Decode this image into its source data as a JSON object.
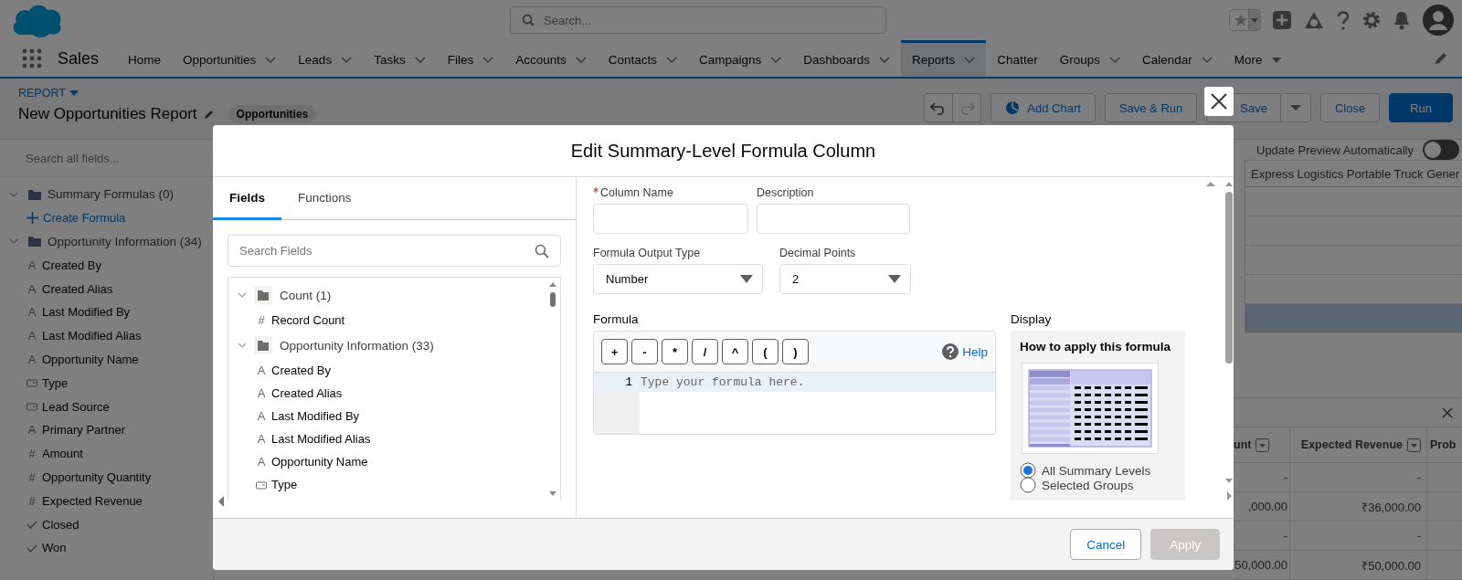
{
  "header": {
    "search": {
      "placeholder": "Search..."
    }
  },
  "nav": {
    "app_name": "Sales",
    "tabs": [
      {
        "label": "Home",
        "selected": false,
        "kind": "plain"
      },
      {
        "label": "Opportunities",
        "selected": false,
        "kind": "dropdown"
      },
      {
        "label": "Leads",
        "selected": false,
        "kind": "dropdown"
      },
      {
        "label": "Tasks",
        "selected": false,
        "kind": "dropdown"
      },
      {
        "label": "Files",
        "selected": false,
        "kind": "dropdown"
      },
      {
        "label": "Accounts",
        "selected": false,
        "kind": "dropdown"
      },
      {
        "label": "Contacts",
        "selected": false,
        "kind": "dropdown"
      },
      {
        "label": "Campaigns",
        "selected": false,
        "kind": "dropdown"
      },
      {
        "label": "Dashboards",
        "selected": false,
        "kind": "dropdown"
      },
      {
        "label": "Reports",
        "selected": true,
        "kind": "dropdown"
      },
      {
        "label": "Chatter",
        "selected": false,
        "kind": "plain"
      },
      {
        "label": "Groups",
        "selected": false,
        "kind": "dropdown"
      },
      {
        "label": "Calendar",
        "selected": false,
        "kind": "dropdown"
      },
      {
        "label": "More",
        "selected": false,
        "kind": "overflow"
      }
    ]
  },
  "report_header": {
    "type_label": "REPORT",
    "title": "New Opportunities Report",
    "object_badge": "Opportunities",
    "buttons": [
      {
        "label": "Add Chart",
        "kind": "chart"
      },
      {
        "label": "Save & Run",
        "kind": "plain"
      },
      {
        "label": "Save",
        "kind": "split"
      },
      {
        "label": "Close",
        "kind": "plain"
      },
      {
        "label": "Run",
        "kind": "primary"
      }
    ]
  },
  "sidebar": {
    "search": {
      "placeholder": "Search all fields..."
    },
    "tree": [
      {
        "label": "Summary Formulas (0)",
        "expanded": true,
        "children": [
          {
            "kind": "action",
            "label": "Create Formula"
          }
        ]
      },
      {
        "label": "Opportunity Information (34)",
        "expanded": true,
        "children": [
          {
            "kind": "text",
            "glyph": "A",
            "label": "Created By"
          },
          {
            "kind": "text",
            "glyph": "A",
            "label": "Created Alias"
          },
          {
            "kind": "text",
            "glyph": "A",
            "label": "Last Modified By"
          },
          {
            "kind": "text",
            "glyph": "A",
            "label": "Last Modified Alias"
          },
          {
            "kind": "text",
            "glyph": "A",
            "label": "Opportunity Name"
          },
          {
            "kind": "picklist",
            "label": "Type"
          },
          {
            "kind": "picklist",
            "label": "Lead Source"
          },
          {
            "kind": "text",
            "glyph": "A",
            "label": "Primary Partner"
          },
          {
            "kind": "number",
            "glyph": "#",
            "label": "Amount"
          },
          {
            "kind": "number",
            "glyph": "#",
            "label": "Opportunity Quantity"
          },
          {
            "kind": "number",
            "glyph": "#",
            "label": "Expected Revenue"
          },
          {
            "kind": "checkbox",
            "label": "Closed"
          },
          {
            "kind": "checkbox",
            "label": "Won"
          }
        ]
      }
    ]
  },
  "preview": {
    "auto_update": {
      "label": "Update Preview Automatically",
      "on": false
    },
    "summary_table": {
      "column_1": "Express Logistics Portable Truck Gener",
      "rows": [
        {
          "selected": false
        },
        {
          "selected": false
        },
        {
          "selected": false
        },
        {
          "selected": false
        },
        {
          "selected": true
        }
      ]
    },
    "detail_table": {
      "columns": [
        {
          "label": "unt",
          "menu": true
        },
        {
          "label": "Expected Revenue",
          "menu": true
        },
        {
          "label": "Prob"
        }
      ],
      "rows": [
        [
          "-",
          "-"
        ],
        [
          ",000.00",
          "₹36,000.00"
        ],
        [
          "-",
          "-"
        ],
        [
          "50,000.00",
          "₹50,000.00"
        ]
      ]
    }
  },
  "dialog": {
    "title": "Edit Summary-Level Formula Column",
    "tabs": [
      {
        "label": "Fields",
        "selected": true
      },
      {
        "label": "Functions",
        "selected": false
      }
    ],
    "field_search": {
      "placeholder": "Search Fields"
    },
    "field_tree": [
      {
        "label": "Count (1)",
        "expanded": true,
        "children": [
          {
            "kind": "number",
            "glyph": "#",
            "label": "Record Count"
          }
        ]
      },
      {
        "label": "Opportunity Information (33)",
        "expanded": true,
        "children": [
          {
            "kind": "text",
            "glyph": "A",
            "label": "Created By"
          },
          {
            "kind": "text",
            "glyph": "A",
            "label": "Created Alias"
          },
          {
            "kind": "text",
            "glyph": "A",
            "label": "Last Modified By"
          },
          {
            "kind": "text",
            "glyph": "A",
            "label": "Last Modified Alias"
          },
          {
            "kind": "text",
            "glyph": "A",
            "label": "Opportunity Name"
          },
          {
            "kind": "picklist",
            "label": "Type"
          }
        ]
      }
    ],
    "column_name": {
      "label": "Column Name",
      "required": true
    },
    "description": {
      "label": "Description"
    },
    "output_type": {
      "label": "Formula Output Type",
      "value": "Number"
    },
    "decimal_points": {
      "label": "Decimal Points",
      "value": "2"
    },
    "formula": {
      "label": "Formula",
      "operators": [
        "+",
        "-",
        "*",
        "/",
        "^",
        "(",
        ")"
      ],
      "help": "Help",
      "line_number": "1",
      "placeholder": "Type your formula here."
    },
    "display": {
      "label": "Display",
      "heading": "How to apply this formula",
      "options": [
        {
          "label": "All Summary Levels",
          "selected": true
        },
        {
          "label": "Selected Groups",
          "selected": false
        }
      ]
    },
    "buttons": [
      {
        "label": "Cancel",
        "disabled": false
      },
      {
        "label": "Apply",
        "disabled": true
      }
    ]
  }
}
